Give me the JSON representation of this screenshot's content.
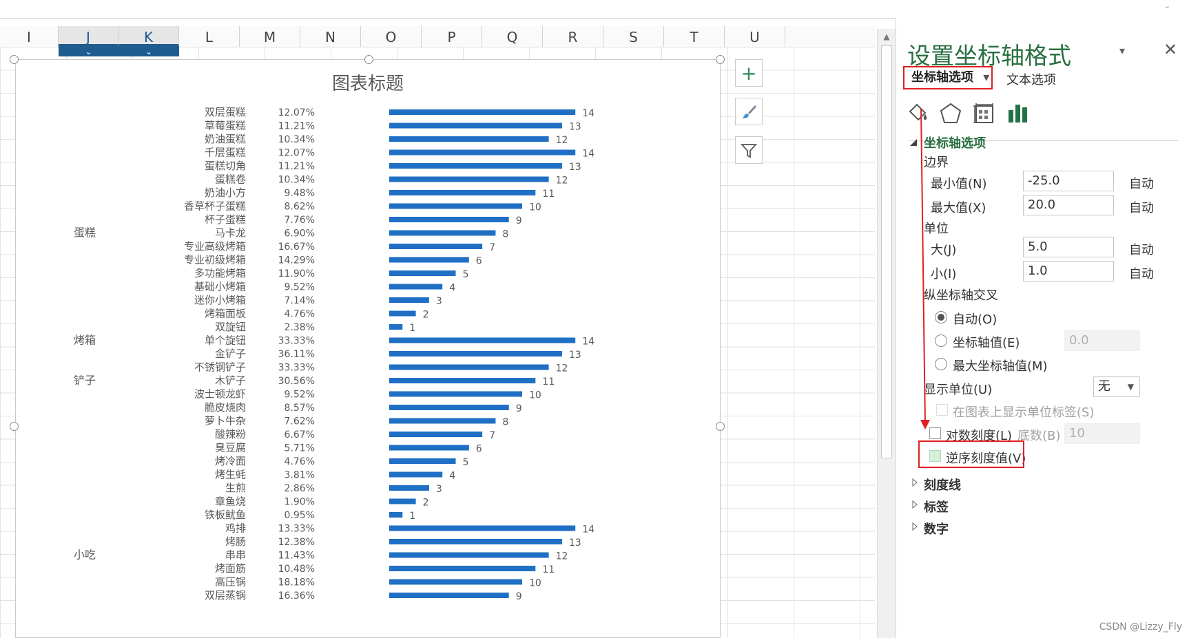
{
  "columns": [
    "I",
    "J",
    "K",
    "L",
    "M",
    "N",
    "O",
    "P",
    "Q",
    "R",
    "S",
    "T",
    "U"
  ],
  "filter_mark": "⌄",
  "chart": {
    "title": "图表标题",
    "rows": [
      {
        "label": "双层蛋糕",
        "pct": "12.07%",
        "value": 14
      },
      {
        "label": "草莓蛋糕",
        "pct": "11.21%",
        "value": 13
      },
      {
        "label": "奶油蛋糕",
        "pct": "10.34%",
        "value": 12
      },
      {
        "label": "千层蛋糕",
        "pct": "12.07%",
        "value": 14
      },
      {
        "label": "蛋糕切角",
        "pct": "11.21%",
        "value": 13
      },
      {
        "label": "蛋糕卷",
        "pct": "10.34%",
        "value": 12
      },
      {
        "label": "奶油小方",
        "pct": "9.48%",
        "value": 11
      },
      {
        "label": "香草杯子蛋糕",
        "pct": "8.62%",
        "value": 10
      },
      {
        "label": "杯子蛋糕",
        "pct": "7.76%",
        "value": 9
      },
      {
        "label": "马卡龙",
        "pct": "6.90%",
        "value": 8
      },
      {
        "label": "专业高级烤箱",
        "pct": "16.67%",
        "value": 7
      },
      {
        "label": "专业初级烤箱",
        "pct": "14.29%",
        "value": 6
      },
      {
        "label": "多功能烤箱",
        "pct": "11.90%",
        "value": 5
      },
      {
        "label": "基础小烤箱",
        "pct": "9.52%",
        "value": 4
      },
      {
        "label": "迷你小烤箱",
        "pct": "7.14%",
        "value": 3
      },
      {
        "label": "烤箱面板",
        "pct": "4.76%",
        "value": 2
      },
      {
        "label": "双旋钮",
        "pct": "2.38%",
        "value": 1
      },
      {
        "label": "单个旋钮",
        "pct": "33.33%",
        "value": 14
      },
      {
        "label": "金铲子",
        "pct": "36.11%",
        "value": 13
      },
      {
        "label": "不锈钢铲子",
        "pct": "33.33%",
        "value": 12
      },
      {
        "label": "木铲子",
        "pct": "30.56%",
        "value": 11
      },
      {
        "label": "波士顿龙虾",
        "pct": "9.52%",
        "value": 10
      },
      {
        "label": "脆皮烧肉",
        "pct": "8.57%",
        "value": 9
      },
      {
        "label": "萝卜牛杂",
        "pct": "7.62%",
        "value": 8
      },
      {
        "label": "酸辣粉",
        "pct": "6.67%",
        "value": 7
      },
      {
        "label": "臭豆腐",
        "pct": "5.71%",
        "value": 6
      },
      {
        "label": "烤冷面",
        "pct": "4.76%",
        "value": 5
      },
      {
        "label": "烤生蚝",
        "pct": "3.81%",
        "value": 4
      },
      {
        "label": "生煎",
        "pct": "2.86%",
        "value": 3
      },
      {
        "label": "章鱼烧",
        "pct": "1.90%",
        "value": 2
      },
      {
        "label": "铁板鱿鱼",
        "pct": "0.95%",
        "value": 1
      },
      {
        "label": "鸡排",
        "pct": "13.33%",
        "value": 14
      },
      {
        "label": "烤肠",
        "pct": "12.38%",
        "value": 13
      },
      {
        "label": "串串",
        "pct": "11.43%",
        "value": 12
      },
      {
        "label": "烤面筋",
        "pct": "10.48%",
        "value": 11
      },
      {
        "label": "高压锅",
        "pct": "18.18%",
        "value": 10
      },
      {
        "label": "双层蒸锅",
        "pct": "16.36%",
        "value": 9
      }
    ],
    "groups": [
      {
        "name": "蛋糕",
        "row": 9
      },
      {
        "name": "烤箱",
        "row": 17
      },
      {
        "name": "铲子",
        "row": 20
      },
      {
        "name": "小吃",
        "row": 33
      }
    ]
  },
  "chart_buttons": {
    "add": "+",
    "style": "brush-icon",
    "filter": "filter-icon"
  },
  "pane": {
    "title": "设置坐标轴格式",
    "dropdown": "▾",
    "close": "✕",
    "tab_axis": "坐标轴选项",
    "tab_axis_caret": "▾",
    "tab_text": "文本选项",
    "section": "坐标轴选项",
    "bounds": "边界",
    "min_label": "最小值(N)",
    "min_value": "-25.0",
    "max_label": "最大值(X)",
    "max_value": "20.0",
    "auto": "自动",
    "units": "单位",
    "major_label": "大(J)",
    "major_value": "5.0",
    "minor_label": "小(I)",
    "minor_value": "1.0",
    "cross": "纵坐标轴交叉",
    "cross_auto": "自动(O)",
    "cross_value": "坐标轴值(E)",
    "cross_value_input": "0.0",
    "cross_max": "最大坐标轴值(M)",
    "display_units": "显示单位(U)",
    "display_units_value": "无",
    "show_unit_label": "在图表上显示单位标签(S)",
    "log_scale": "对数刻度(L)",
    "base_label": "底数(B)",
    "base_value": "10",
    "reverse": "逆序刻度值(V)",
    "tick_marks": "刻度线",
    "labels": "标签",
    "number": "数字"
  },
  "colors": {
    "bar": "#1f6fc5",
    "accent": "#2a7041",
    "highlight": "#e02020"
  },
  "watermark": "CSDN @Lizzy_Fly"
}
